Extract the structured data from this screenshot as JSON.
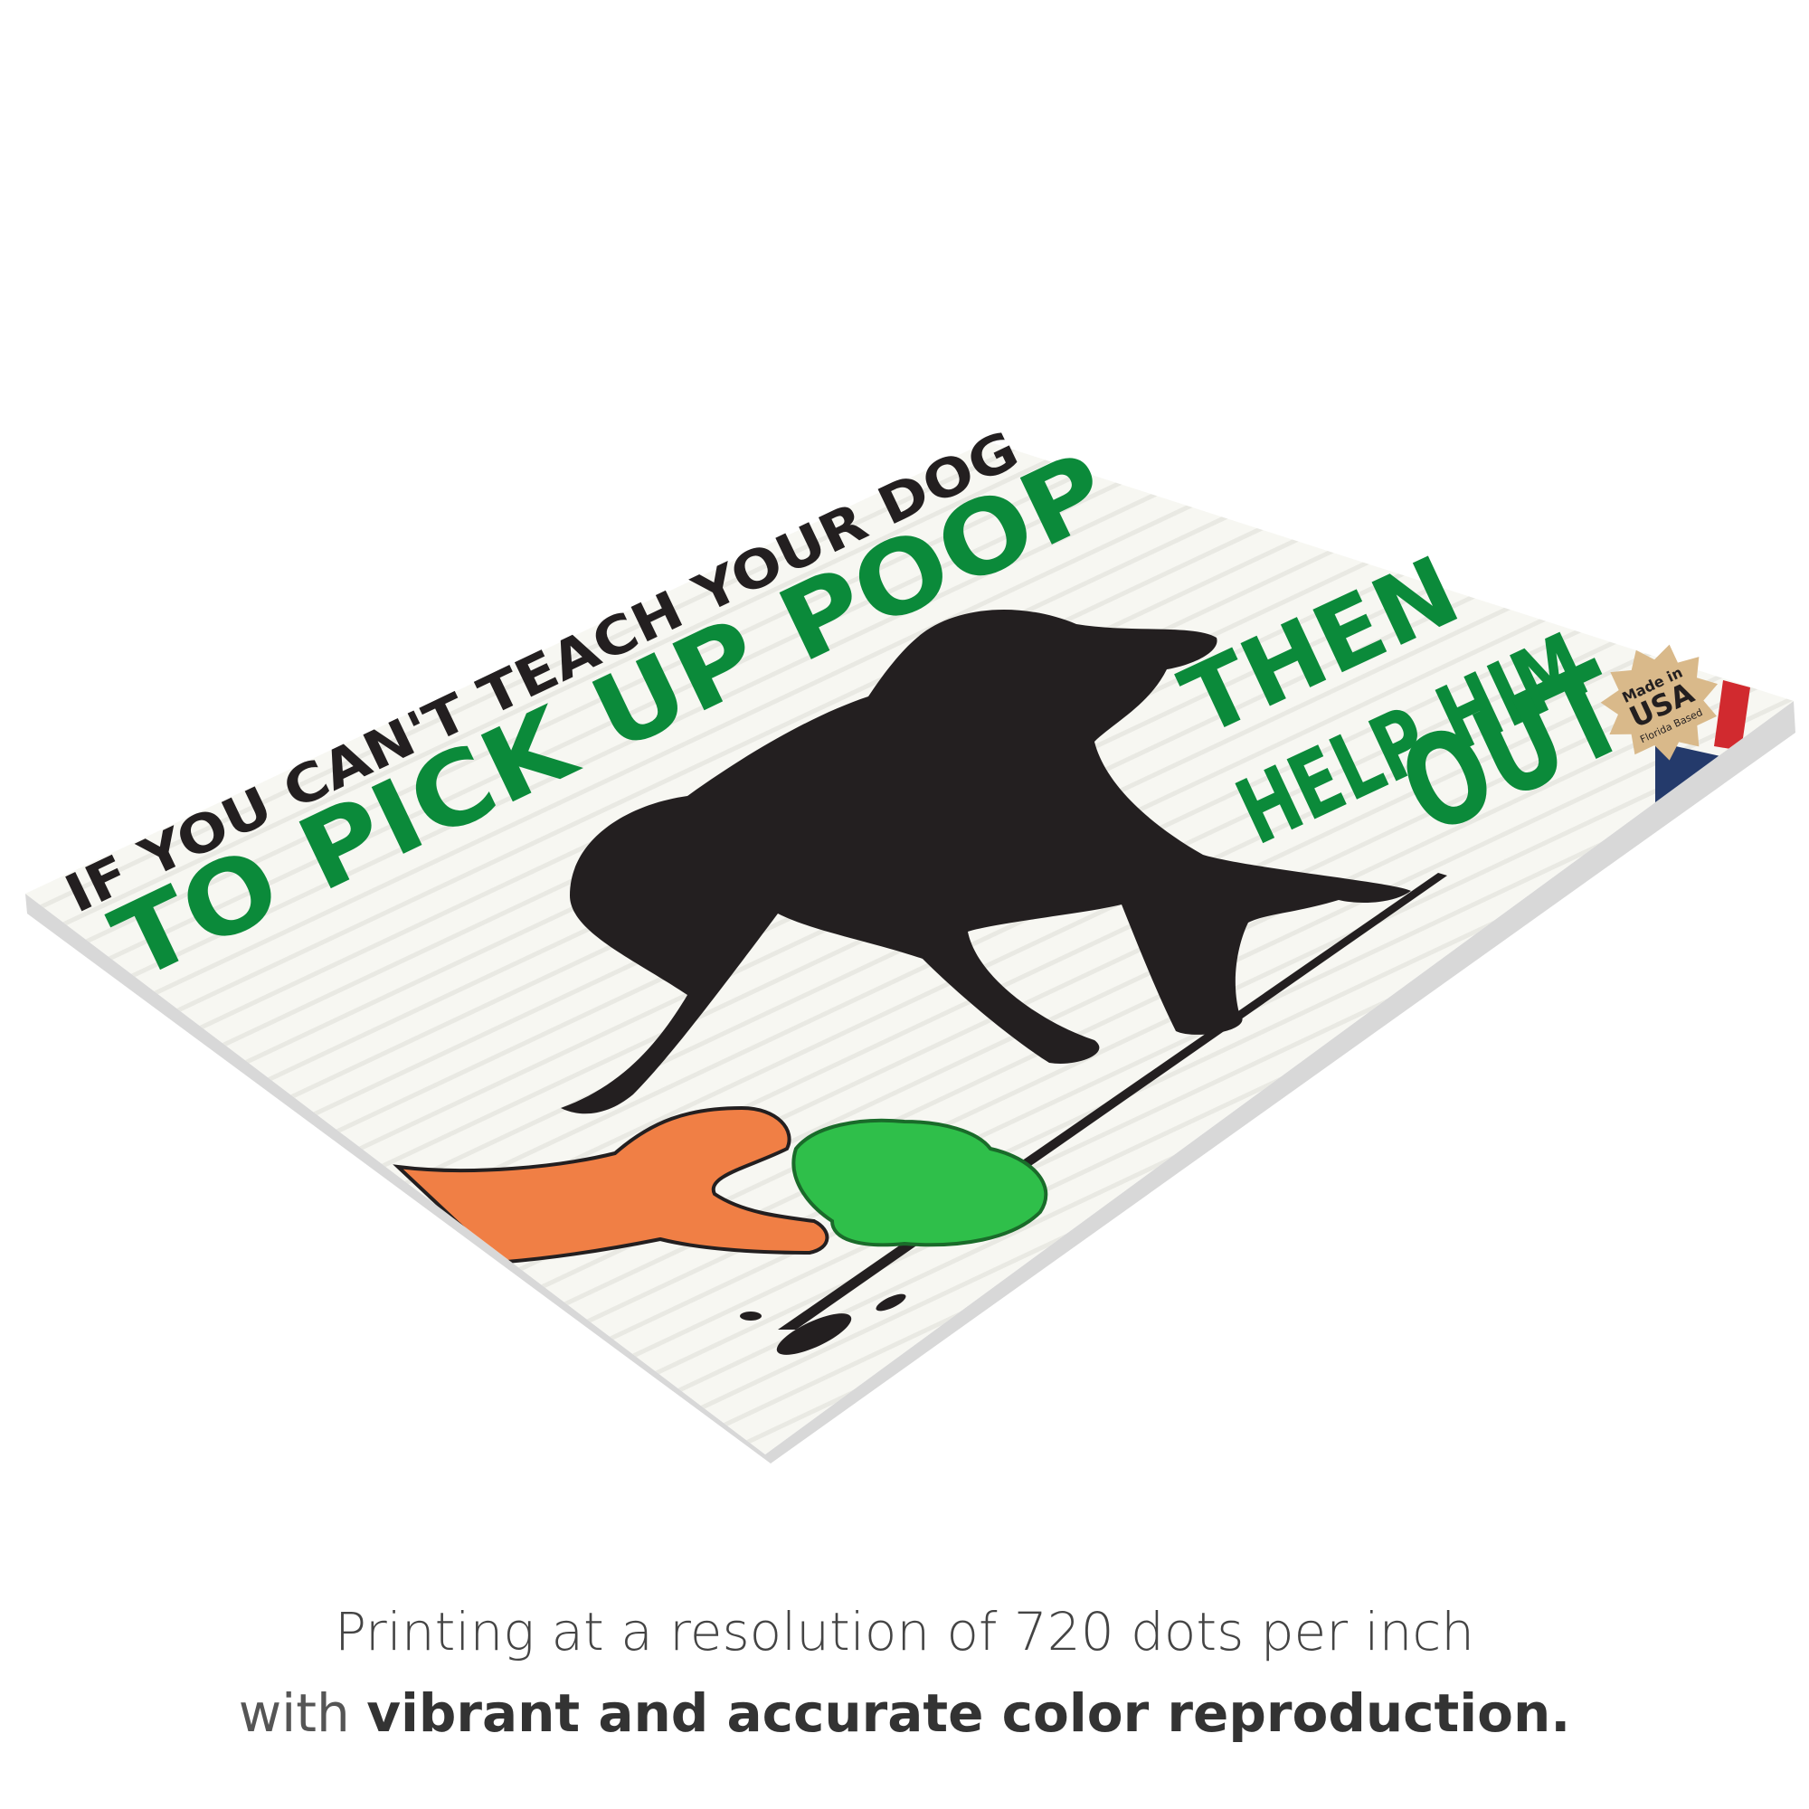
{
  "sign": {
    "line1": "IF YOU CAN'T TEACH YOUR DOG",
    "line2": "TO PICK UP POOP",
    "line3": "THEN",
    "line4": "HELP HIM",
    "line5": "OUT",
    "badge": {
      "top": "Made in",
      "main": "USA",
      "bottom": "Florida Based"
    },
    "colors": {
      "green": "#0b8a3a",
      "black": "#231f20",
      "orange": "#f07f45",
      "poop": "#2fbf4a",
      "board": "#f6f6f0"
    }
  },
  "caption": {
    "line1": "Printing at a resolution of 720 dots per inch",
    "line2_regular": "with",
    "line2_bold": "vibrant and accurate color reproduction."
  }
}
